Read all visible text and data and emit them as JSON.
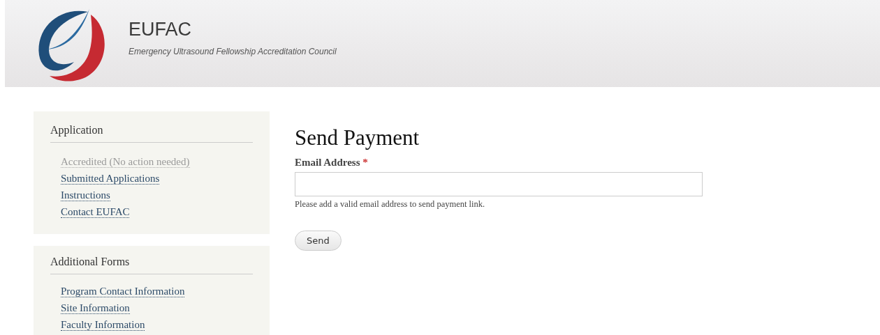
{
  "header": {
    "title": "EUFAC",
    "subtitle": "Emergency Ultrasound Fellowship Accreditation Council"
  },
  "sidebar": [
    {
      "title": "Application",
      "items": [
        {
          "label": "Accredited (No action needed)",
          "disabled": true
        },
        {
          "label": "Submitted Applications",
          "disabled": false
        },
        {
          "label": "Instructions",
          "disabled": false
        },
        {
          "label": "Contact EUFAC",
          "disabled": false
        }
      ]
    },
    {
      "title": "Additional Forms",
      "items": [
        {
          "label": "Program Contact Information",
          "disabled": false
        },
        {
          "label": "Site Information",
          "disabled": false
        },
        {
          "label": "Faculty Information",
          "disabled": false
        }
      ]
    }
  ],
  "form": {
    "title": "Send Payment",
    "field": {
      "label": "Email Address",
      "required_mark": "*",
      "description": "Please add a valid email address to send payment link."
    },
    "button": "Send"
  }
}
